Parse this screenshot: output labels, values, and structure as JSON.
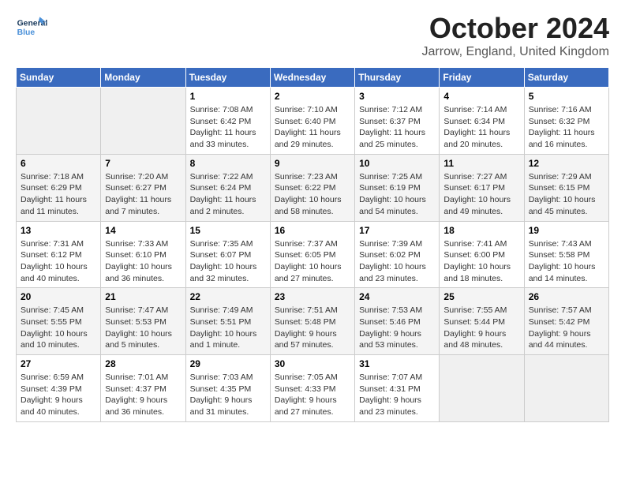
{
  "header": {
    "logo_general": "General",
    "logo_blue": "Blue",
    "month_title": "October 2024",
    "location": "Jarrow, England, United Kingdom"
  },
  "weekdays": [
    "Sunday",
    "Monday",
    "Tuesday",
    "Wednesday",
    "Thursday",
    "Friday",
    "Saturday"
  ],
  "weeks": [
    [
      {
        "day": "",
        "info": ""
      },
      {
        "day": "",
        "info": ""
      },
      {
        "day": "1",
        "info": "Sunrise: 7:08 AM\nSunset: 6:42 PM\nDaylight: 11 hours and 33 minutes."
      },
      {
        "day": "2",
        "info": "Sunrise: 7:10 AM\nSunset: 6:40 PM\nDaylight: 11 hours and 29 minutes."
      },
      {
        "day": "3",
        "info": "Sunrise: 7:12 AM\nSunset: 6:37 PM\nDaylight: 11 hours and 25 minutes."
      },
      {
        "day": "4",
        "info": "Sunrise: 7:14 AM\nSunset: 6:34 PM\nDaylight: 11 hours and 20 minutes."
      },
      {
        "day": "5",
        "info": "Sunrise: 7:16 AM\nSunset: 6:32 PM\nDaylight: 11 hours and 16 minutes."
      }
    ],
    [
      {
        "day": "6",
        "info": "Sunrise: 7:18 AM\nSunset: 6:29 PM\nDaylight: 11 hours and 11 minutes."
      },
      {
        "day": "7",
        "info": "Sunrise: 7:20 AM\nSunset: 6:27 PM\nDaylight: 11 hours and 7 minutes."
      },
      {
        "day": "8",
        "info": "Sunrise: 7:22 AM\nSunset: 6:24 PM\nDaylight: 11 hours and 2 minutes."
      },
      {
        "day": "9",
        "info": "Sunrise: 7:23 AM\nSunset: 6:22 PM\nDaylight: 10 hours and 58 minutes."
      },
      {
        "day": "10",
        "info": "Sunrise: 7:25 AM\nSunset: 6:19 PM\nDaylight: 10 hours and 54 minutes."
      },
      {
        "day": "11",
        "info": "Sunrise: 7:27 AM\nSunset: 6:17 PM\nDaylight: 10 hours and 49 minutes."
      },
      {
        "day": "12",
        "info": "Sunrise: 7:29 AM\nSunset: 6:15 PM\nDaylight: 10 hours and 45 minutes."
      }
    ],
    [
      {
        "day": "13",
        "info": "Sunrise: 7:31 AM\nSunset: 6:12 PM\nDaylight: 10 hours and 40 minutes."
      },
      {
        "day": "14",
        "info": "Sunrise: 7:33 AM\nSunset: 6:10 PM\nDaylight: 10 hours and 36 minutes."
      },
      {
        "day": "15",
        "info": "Sunrise: 7:35 AM\nSunset: 6:07 PM\nDaylight: 10 hours and 32 minutes."
      },
      {
        "day": "16",
        "info": "Sunrise: 7:37 AM\nSunset: 6:05 PM\nDaylight: 10 hours and 27 minutes."
      },
      {
        "day": "17",
        "info": "Sunrise: 7:39 AM\nSunset: 6:02 PM\nDaylight: 10 hours and 23 minutes."
      },
      {
        "day": "18",
        "info": "Sunrise: 7:41 AM\nSunset: 6:00 PM\nDaylight: 10 hours and 18 minutes."
      },
      {
        "day": "19",
        "info": "Sunrise: 7:43 AM\nSunset: 5:58 PM\nDaylight: 10 hours and 14 minutes."
      }
    ],
    [
      {
        "day": "20",
        "info": "Sunrise: 7:45 AM\nSunset: 5:55 PM\nDaylight: 10 hours and 10 minutes."
      },
      {
        "day": "21",
        "info": "Sunrise: 7:47 AM\nSunset: 5:53 PM\nDaylight: 10 hours and 5 minutes."
      },
      {
        "day": "22",
        "info": "Sunrise: 7:49 AM\nSunset: 5:51 PM\nDaylight: 10 hours and 1 minute."
      },
      {
        "day": "23",
        "info": "Sunrise: 7:51 AM\nSunset: 5:48 PM\nDaylight: 9 hours and 57 minutes."
      },
      {
        "day": "24",
        "info": "Sunrise: 7:53 AM\nSunset: 5:46 PM\nDaylight: 9 hours and 53 minutes."
      },
      {
        "day": "25",
        "info": "Sunrise: 7:55 AM\nSunset: 5:44 PM\nDaylight: 9 hours and 48 minutes."
      },
      {
        "day": "26",
        "info": "Sunrise: 7:57 AM\nSunset: 5:42 PM\nDaylight: 9 hours and 44 minutes."
      }
    ],
    [
      {
        "day": "27",
        "info": "Sunrise: 6:59 AM\nSunset: 4:39 PM\nDaylight: 9 hours and 40 minutes."
      },
      {
        "day": "28",
        "info": "Sunrise: 7:01 AM\nSunset: 4:37 PM\nDaylight: 9 hours and 36 minutes."
      },
      {
        "day": "29",
        "info": "Sunrise: 7:03 AM\nSunset: 4:35 PM\nDaylight: 9 hours and 31 minutes."
      },
      {
        "day": "30",
        "info": "Sunrise: 7:05 AM\nSunset: 4:33 PM\nDaylight: 9 hours and 27 minutes."
      },
      {
        "day": "31",
        "info": "Sunrise: 7:07 AM\nSunset: 4:31 PM\nDaylight: 9 hours and 23 minutes."
      },
      {
        "day": "",
        "info": ""
      },
      {
        "day": "",
        "info": ""
      }
    ]
  ]
}
